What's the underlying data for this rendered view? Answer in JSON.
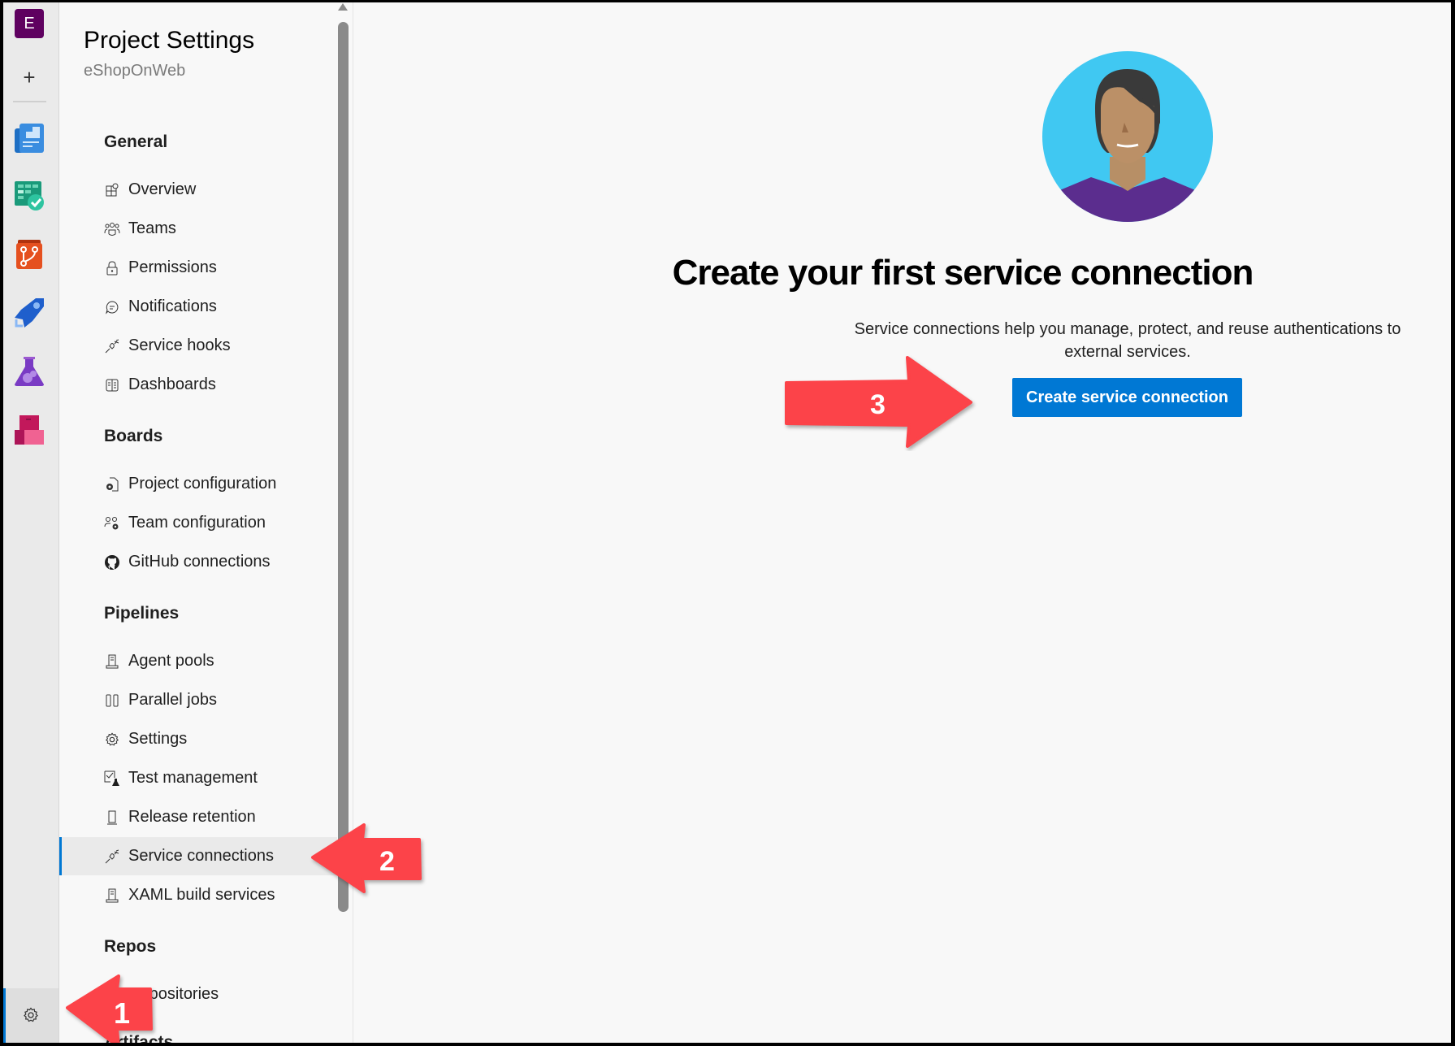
{
  "rail": {
    "org_initial": "E",
    "add_icon": "plus-icon",
    "services": [
      {
        "name": "Overview",
        "icon": "overview-icon"
      },
      {
        "name": "Boards",
        "icon": "boards-icon"
      },
      {
        "name": "Repos",
        "icon": "repos-icon"
      },
      {
        "name": "Pipelines",
        "icon": "pipelines-icon"
      },
      {
        "name": "Test Plans",
        "icon": "test-plans-icon"
      },
      {
        "name": "Artifacts",
        "icon": "artifacts-icon"
      }
    ],
    "settings_icon": "gear-icon"
  },
  "panel": {
    "title": "Project Settings",
    "project": "eShopOnWeb",
    "sections": [
      {
        "label": "General",
        "items": [
          {
            "label": "Overview",
            "icon": "overview-icon"
          },
          {
            "label": "Teams",
            "icon": "teams-icon"
          },
          {
            "label": "Permissions",
            "icon": "lock-icon"
          },
          {
            "label": "Notifications",
            "icon": "chat-icon"
          },
          {
            "label": "Service hooks",
            "icon": "plug-icon"
          },
          {
            "label": "Dashboards",
            "icon": "dashboard-icon"
          }
        ]
      },
      {
        "label": "Boards",
        "items": [
          {
            "label": "Project configuration",
            "icon": "document-gear-icon"
          },
          {
            "label": "Team configuration",
            "icon": "people-gear-icon"
          },
          {
            "label": "GitHub connections",
            "icon": "github-icon"
          }
        ]
      },
      {
        "label": "Pipelines",
        "items": [
          {
            "label": "Agent pools",
            "icon": "build-agent-icon"
          },
          {
            "label": "Parallel jobs",
            "icon": "parallel-icon"
          },
          {
            "label": "Settings",
            "icon": "gear-icon"
          },
          {
            "label": "Test management",
            "icon": "test-management-icon"
          },
          {
            "label": "Release retention",
            "icon": "phone-icon"
          },
          {
            "label": "Service connections",
            "icon": "plug-icon",
            "selected": true
          },
          {
            "label": "XAML build services",
            "icon": "build-agent-icon"
          }
        ]
      },
      {
        "label": "Repos",
        "items": [
          {
            "label": "Repositories",
            "icon": "repo-icon"
          }
        ]
      },
      {
        "label": "Artifacts",
        "items": []
      }
    ]
  },
  "main": {
    "heading": "Create your first service connection",
    "description": "Service connections help you manage, protect, and reuse authentications to external services.",
    "cta_label": "Create service connection",
    "accent": "#0078d4"
  },
  "annotations": [
    {
      "number": "1",
      "target": "Project settings gear",
      "color": "#fc4349"
    },
    {
      "number": "2",
      "target": "Service connections",
      "color": "#fc4349"
    },
    {
      "number": "3",
      "target": "Create service connection",
      "color": "#fc4349"
    }
  ]
}
